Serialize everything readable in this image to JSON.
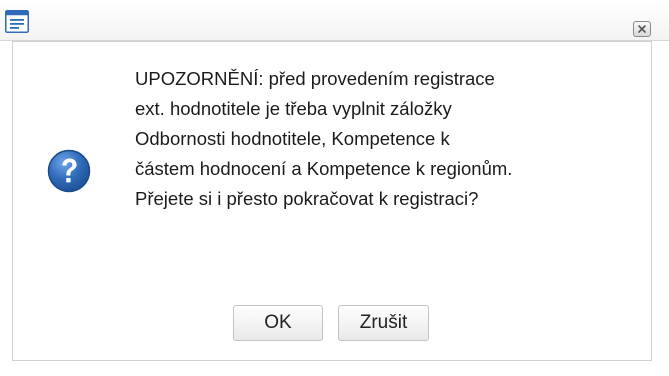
{
  "window": {
    "app_icon": "document-window-icon",
    "close_icon": "close-x-icon"
  },
  "dialog": {
    "icon": "question-mark-icon",
    "message_lines": [
      "UPOZORNĚNÍ: před provedením registrace",
      "ext. hodnotitele je třeba vyplnit záložky",
      "Odbornosti hodnotitele, Kompetence k",
      "částem hodnocení a Kompetence k regionům.",
      "Přejete si i přesto pokračovat k registraci?"
    ],
    "buttons": {
      "ok_label": "OK",
      "cancel_label": "Zrušit"
    }
  },
  "colors": {
    "accent_blue": "#2f6bb8",
    "text": "#1b1b1b",
    "border": "#cfcfcf"
  }
}
